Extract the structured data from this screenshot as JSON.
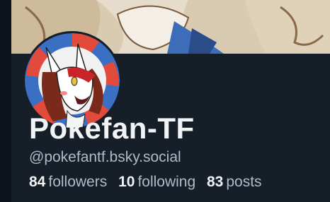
{
  "profile": {
    "display_name": "Pokefan-TF",
    "handle": "@pokefantf.bsky.social",
    "avatar_icon": "character-avatar",
    "banner_icon": "cartoon-banner"
  },
  "stats": [
    {
      "count": "84",
      "label": "followers"
    },
    {
      "count": "10",
      "label": "following"
    },
    {
      "count": "83",
      "label": "posts"
    }
  ],
  "colors": {
    "background": "#161e27",
    "text_primary": "#f1f3f5",
    "text_secondary": "#aebbc9"
  }
}
